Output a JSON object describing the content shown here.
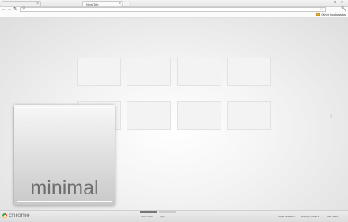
{
  "tabs": [
    {
      "title": "",
      "active": false
    },
    {
      "title": "New Tab",
      "active": true
    }
  ],
  "window_controls": [
    "–",
    "□",
    "×"
  ],
  "toolbar": {
    "back_icon": "back-arrow-icon",
    "forward_icon": "forward-arrow-icon",
    "reload_icon": "reload-icon",
    "omnibox_value": "",
    "star_icon": "star-icon",
    "wrench_icon": "wrench-icon"
  },
  "bookmarks_bar": {
    "other_bookmarks": "Other bookmarks"
  },
  "most_visited": {
    "tile_count": 8
  },
  "bottom_bar": {
    "brand": "chrome",
    "sections": [
      {
        "label": "Most visited",
        "active": true
      },
      {
        "label": "Apps",
        "active": false
      }
    ],
    "footer_links": [
      {
        "label": "Other devices ▾"
      },
      {
        "label": "Recently closed ▾"
      },
      {
        "label": "Web Store"
      }
    ]
  },
  "theme": {
    "name": "minimal"
  },
  "colors": {
    "background_light": "#ffffff",
    "background_dark": "#dedede",
    "tile": "#f3f3f3",
    "section_indicator_active": "#777777",
    "section_indicator_inactive": "#cccccc"
  }
}
